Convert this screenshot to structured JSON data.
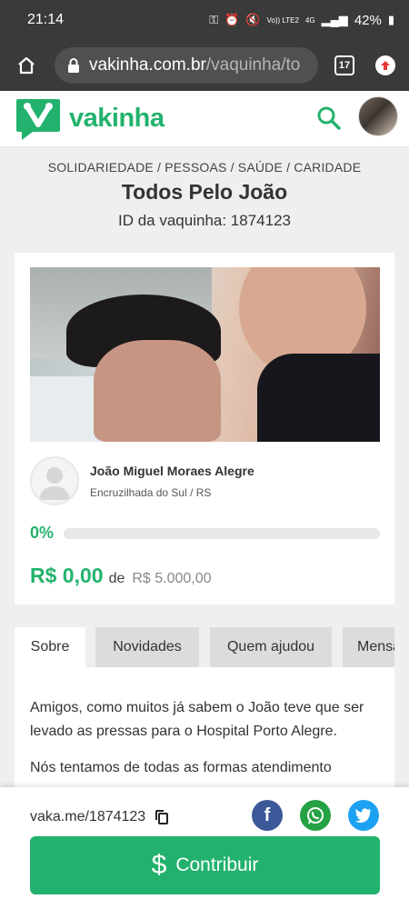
{
  "status_bar": {
    "time": "21:14",
    "network": "Vo)) LTE2",
    "signal_type": "4G",
    "battery": "42%"
  },
  "browser": {
    "url_domain": "vakinha.com.br",
    "url_path": "/vaquinha/to",
    "tab_count": "17"
  },
  "site": {
    "logo_text": "vakinha",
    "brand_color": "#23b26d"
  },
  "campaign": {
    "categories": "SOLIDARIEDADE / PESSOAS / SAÚDE / CARIDADE",
    "title": "Todos Pelo João",
    "id_label": "ID da vaquinha: 1874123",
    "owner_name": "João Miguel Moraes Alegre",
    "owner_location": "Encruzilhada do Sul / RS",
    "progress_text": "0%",
    "progress_fraction": 0,
    "raised": "R$ 0,00",
    "of_label": "de",
    "goal": "R$ 5.000,00"
  },
  "tabs": [
    {
      "label": "Sobre",
      "active": true
    },
    {
      "label": "Novidades",
      "active": false
    },
    {
      "label": "Quem ajudou",
      "active": false
    },
    {
      "label": "Mensa",
      "active": false
    }
  ],
  "description": [
    "Amigos, como muitos já sabem o João teve que ser levado as pressas para o Hospital Porto Alegre.",
    "Nós tentamos de todas as formas atendimento"
  ],
  "footer": {
    "share_link": "vaka.me/1874123",
    "social_icons": [
      "facebook-icon",
      "whatsapp-icon",
      "twitter-icon"
    ],
    "contribute_label": "Contribuir"
  }
}
